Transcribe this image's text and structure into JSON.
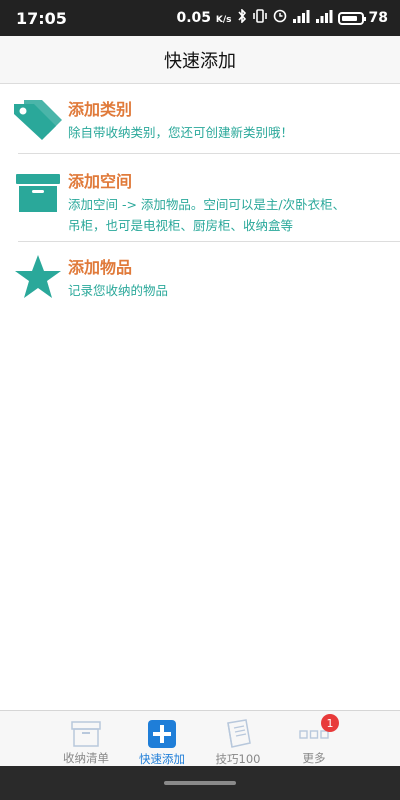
{
  "status": {
    "time": "17:05",
    "speed": "0.05",
    "speed_unit": "K/s",
    "battery": "78"
  },
  "header": {
    "title": "快速添加"
  },
  "items": [
    {
      "title": "添加类别",
      "desc": "除自带收纳类别，您还可创建新类别哦！",
      "icon": "tag-icon"
    },
    {
      "title": "添加空间",
      "desc_line1": "添加空间 -> 添加物品。空间可以是主/次卧衣柜、",
      "desc_line2": "吊柜，也可是电视柜、厨房柜、收纳盒等",
      "icon": "storage-box-icon"
    },
    {
      "title": "添加物品",
      "desc": "记录您收纳的物品",
      "icon": "star-icon"
    }
  ],
  "tabs": [
    {
      "label": "收纳清单",
      "icon": "box-outline-icon",
      "active": false
    },
    {
      "label": "快速添加",
      "icon": "plus-square-icon",
      "active": true
    },
    {
      "label": "技巧100",
      "icon": "book-icon",
      "active": false
    },
    {
      "label": "更多",
      "icon": "more-dots-icon",
      "active": false,
      "badge": "1"
    }
  ],
  "colors": {
    "accent_orange": "#e07a3a",
    "accent_teal": "#2aa89a",
    "tab_active": "#1f7ed8"
  }
}
